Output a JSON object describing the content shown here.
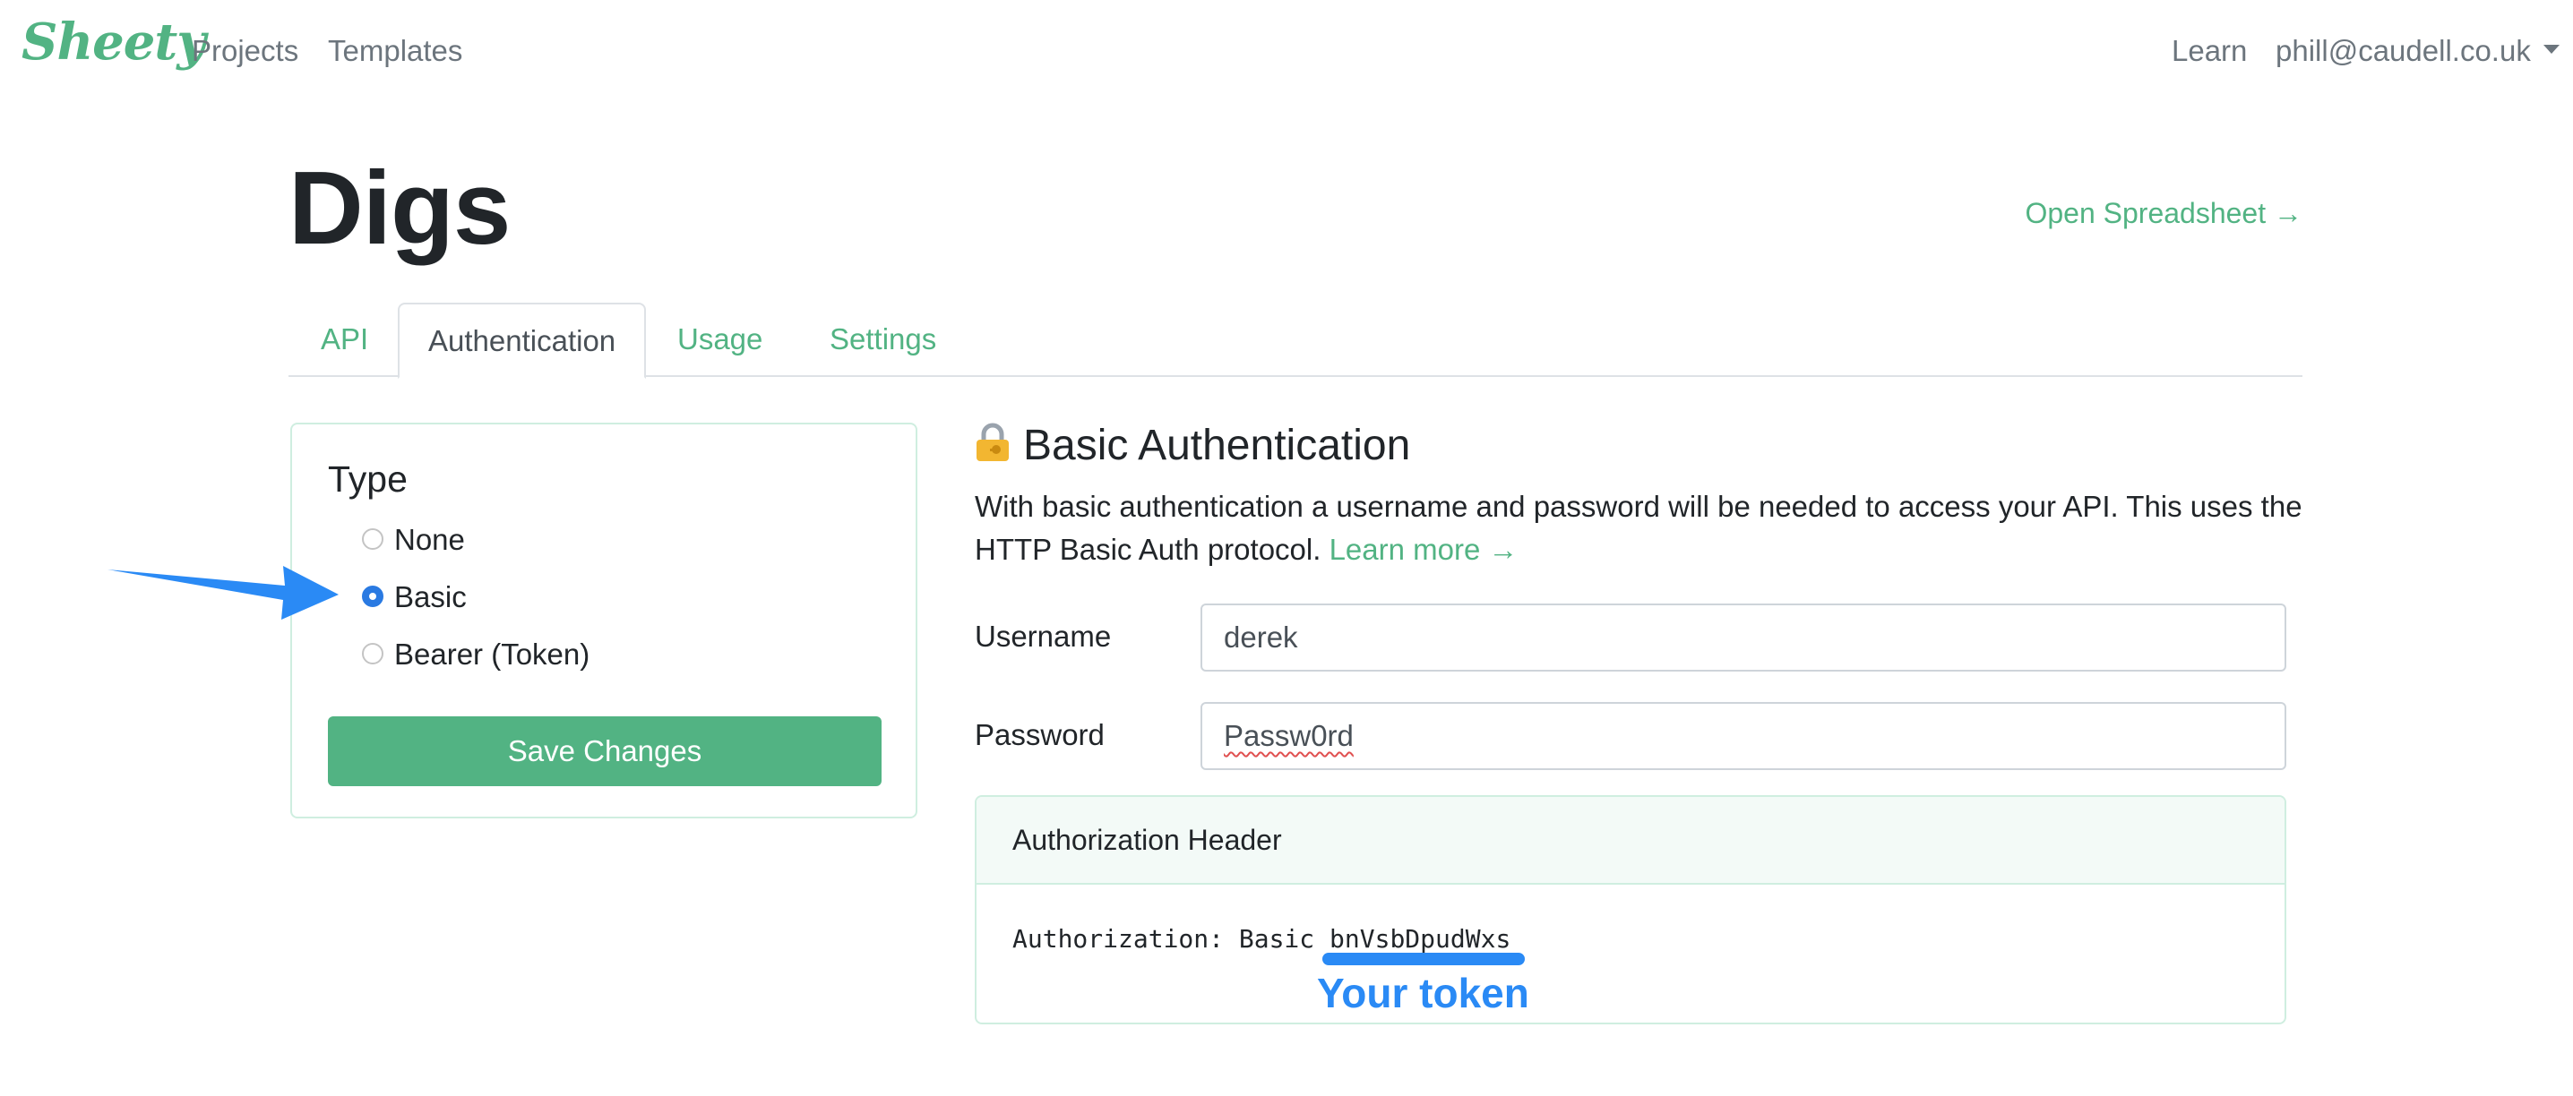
{
  "navbar": {
    "logo": "Sheety",
    "links": [
      "Projects",
      "Templates"
    ],
    "learn": "Learn",
    "user": "phill@caudell.co.uk"
  },
  "project": {
    "title": "Digs",
    "open_spreadsheet": "Open Spreadsheet →"
  },
  "tabs": [
    {
      "label": "API",
      "active": false
    },
    {
      "label": "Authentication",
      "active": true
    },
    {
      "label": "Usage",
      "active": false
    },
    {
      "label": "Settings",
      "active": false
    }
  ],
  "type_card": {
    "title": "Type",
    "options": [
      {
        "label": "None",
        "checked": false
      },
      {
        "label": "Basic",
        "checked": true
      },
      {
        "label": "Bearer (Token)",
        "checked": false
      }
    ],
    "save_label": "Save Changes"
  },
  "basic_auth": {
    "title": "Basic Authentication",
    "description": "With basic authentication a username and password will be needed to access your API. This uses the HTTP Basic Auth protocol.",
    "learn_more": "Learn more →",
    "username_label": "Username",
    "username_value": "derek",
    "password_label": "Password",
    "password_value": "Passw0rd",
    "header_title": "Authorization Header",
    "header_prefix": "Authorization: Basic ",
    "token": "bnVsbDpudWxs"
  },
  "annotation": {
    "token_label": "Your token"
  },
  "colors": {
    "brand_green": "#52b383",
    "annotation_blue": "#2a8af5",
    "radio_checked": "#2a7ae2"
  }
}
